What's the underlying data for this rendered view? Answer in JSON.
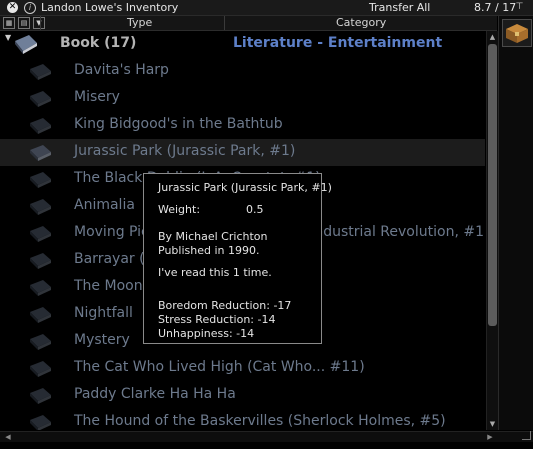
{
  "window": {
    "title": "Landon Lowe's Inventory",
    "transfer_label": "Transfer All",
    "weight": "8.7 / 17"
  },
  "header": {
    "type_label": "Type",
    "category_label": "Category"
  },
  "group": {
    "label": "Book (17)",
    "category": "Literature - Entertainment"
  },
  "items": [
    {
      "label": "Davita's Harp"
    },
    {
      "label": "Misery"
    },
    {
      "label": "King Bidgood's in the Bathtub"
    },
    {
      "label": "Jurassic Park (Jurassic Park, #1)"
    },
    {
      "label": "The Black Dahlia (L.A. Quartet, #1)"
    },
    {
      "label": "Animalia"
    },
    {
      "label": "Moving Pictures (Discworld, #10; Industrial Revolution, #1)"
    },
    {
      "label": "Barrayar (Vorkosigan Saga, #7)"
    },
    {
      "label": "The Moon and Sixpence"
    },
    {
      "label": "Nightfall"
    },
    {
      "label": "Mystery"
    },
    {
      "label": "The Cat Who Lived High (Cat Who... #11)"
    },
    {
      "label": "Paddy Clarke Ha Ha Ha"
    },
    {
      "label": "The Hound of the Baskervilles (Sherlock Holmes, #5)"
    }
  ],
  "selected_index": 3,
  "tooltip": {
    "title": "Jurassic Park (Jurassic Park, #1)",
    "weight_label": "Weight:",
    "weight_value": "0.5",
    "author": "By Michael Crichton",
    "published": "Published in 1990.",
    "read_count": "I've read this 1 time.",
    "boredom": "Boredom Reduction: -17",
    "stress": "Stress Reduction: -14",
    "unhappiness": "Unhappiness: -14"
  },
  "colors": {
    "item_text": "#6d7a8d",
    "category_text": "#5d80c8",
    "group_text": "#b4b4b4"
  }
}
